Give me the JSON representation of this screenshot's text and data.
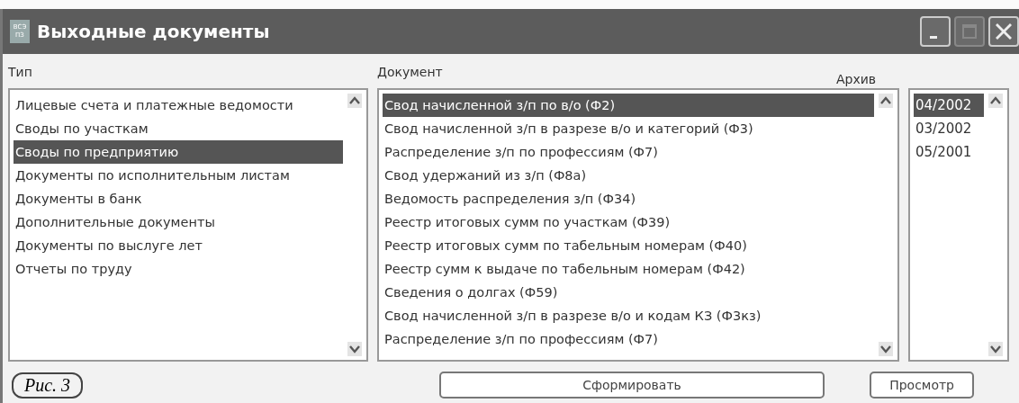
{
  "window": {
    "title": "Выходные документы",
    "icon_text": "ВСЭ\nПЗ"
  },
  "type_panel": {
    "label": "Тип",
    "items": [
      {
        "text": "Лицевые счета и платежные ведомости",
        "selected": false
      },
      {
        "text": "Своды по участкам",
        "selected": false
      },
      {
        "text": "Своды по предприятию",
        "selected": true
      },
      {
        "text": "Документы по исполнительным листам",
        "selected": false
      },
      {
        "text": "Документы в банк",
        "selected": false
      },
      {
        "text": "Дополнительные документы",
        "selected": false
      },
      {
        "text": "Документы по выслуге лет",
        "selected": false
      },
      {
        "text": "Отчеты по труду",
        "selected": false
      }
    ]
  },
  "document_panel": {
    "label": "Документ",
    "items": [
      {
        "text": "Свод начисленной з/п по в/о (Ф2)",
        "selected": true
      },
      {
        "text": "Свод начисленной з/п в разрезе в/о и категорий (Ф3)",
        "selected": false
      },
      {
        "text": "Распределение з/п по профессиям (Ф7)",
        "selected": false
      },
      {
        "text": "Свод удержаний из з/п (Ф8а)",
        "selected": false
      },
      {
        "text": "Ведомость распределения з/п (Ф34)",
        "selected": false
      },
      {
        "text": "Реестр итоговых сумм по участкам (Ф39)",
        "selected": false
      },
      {
        "text": "Реестр итоговых сумм по табельным номерам (Ф40)",
        "selected": false
      },
      {
        "text": "Реестр сумм к выдаче по табельным номерам (Ф42)",
        "selected": false
      },
      {
        "text": "Сведения о долгах (Ф59)",
        "selected": false
      },
      {
        "text": "Свод начисленной з/п в разрезе в/о и кодам КЗ (Ф3кз)",
        "selected": false
      },
      {
        "text": "Распределение з/п по профессиям (Ф7)",
        "selected": false
      }
    ]
  },
  "archive_panel": {
    "label": "Архив",
    "items": [
      {
        "text": "04/2002",
        "selected": true
      },
      {
        "text": "03/2002",
        "selected": false
      },
      {
        "text": "05/2001",
        "selected": false
      }
    ]
  },
  "caption": "Рис. 3",
  "buttons": [
    "Сформировать",
    "Просмотр"
  ]
}
